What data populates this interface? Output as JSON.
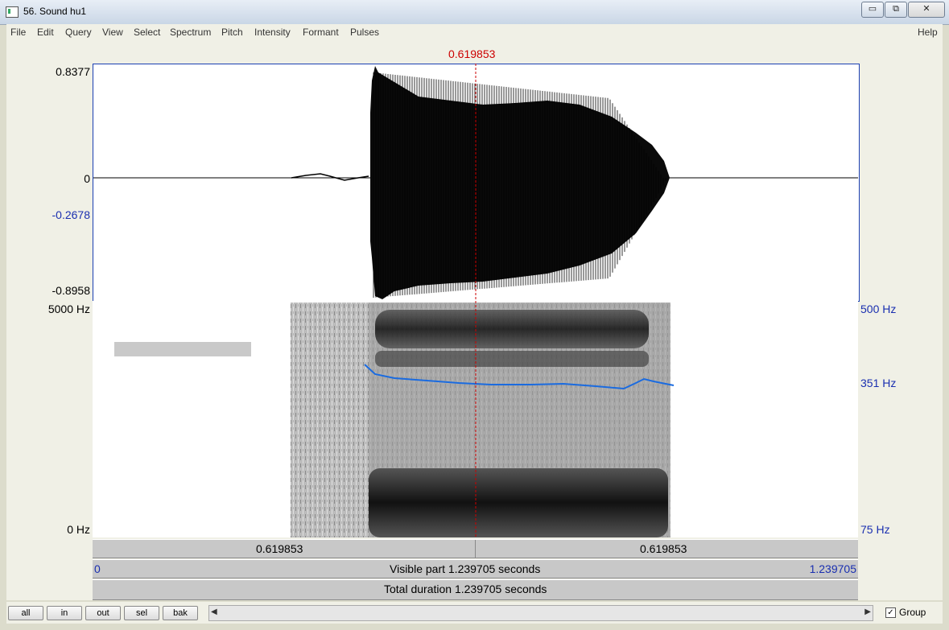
{
  "window": {
    "title": "56. Sound hu1",
    "controls": [
      "▭",
      "⧉",
      "✕"
    ]
  },
  "menu": {
    "items": [
      "File",
      "Edit",
      "Query",
      "View",
      "Select",
      "Spectrum",
      "Pitch",
      "Intensity",
      "Formant",
      "Pulses"
    ],
    "help": "Help"
  },
  "cursor": {
    "time": "0.619853"
  },
  "waveform": {
    "max_label": "0.8377",
    "zero_label": "0",
    "cursor_value_label": "-0.2678",
    "min_label": "-0.8958"
  },
  "spectrogram": {
    "top_freq": "5000 Hz",
    "bottom_freq": "0 Hz"
  },
  "pitch": {
    "top": "500 Hz",
    "value": "351 Hz",
    "bottom": "75 Hz"
  },
  "time_bars": {
    "left_time": "0.619853",
    "right_time": "0.619853",
    "visible_start": "0",
    "visible_text": "Visible part 1.239705 seconds",
    "visible_end": "1.239705",
    "total_text": "Total duration 1.239705 seconds"
  },
  "buttons": {
    "all": "all",
    "in": "in",
    "out": "out",
    "sel": "sel",
    "bak": "bak"
  },
  "group": {
    "label": "Group",
    "checked": true
  },
  "colors": {
    "cursor": "#cc0000",
    "pitch_line": "#1a6be0",
    "axis_blue": "#1a2fb0"
  },
  "icons": {
    "scroll_left": "◀",
    "scroll_right": "▶",
    "check": "✓"
  }
}
